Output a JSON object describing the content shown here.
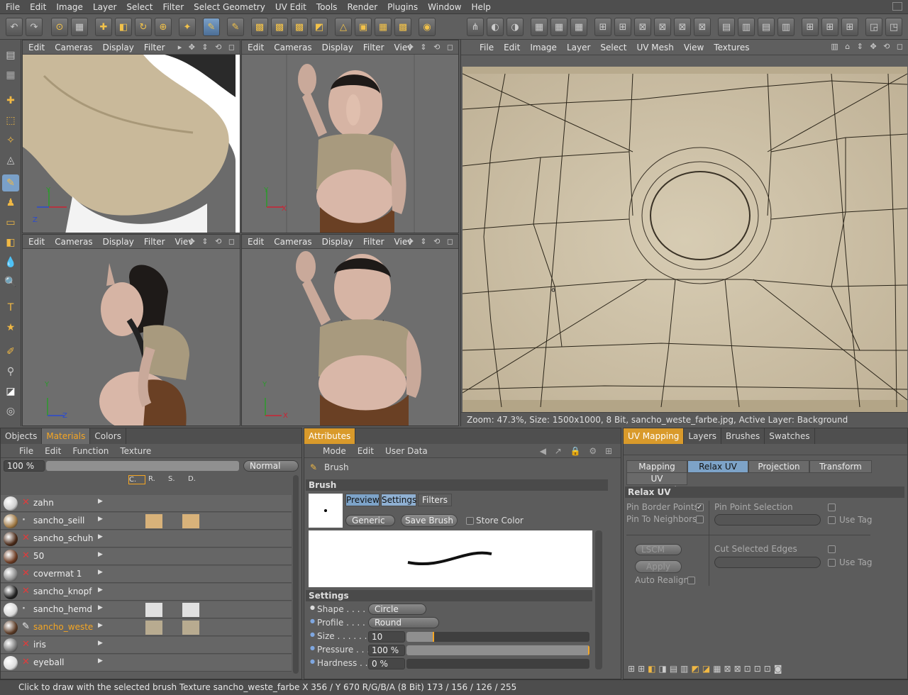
{
  "menu": [
    "File",
    "Edit",
    "Image",
    "Layer",
    "Select",
    "Filter",
    "Select Geometry",
    "UV Edit",
    "Tools",
    "Render",
    "Plugins",
    "Window",
    "Help"
  ],
  "viewport": {
    "menu": [
      "Edit",
      "Cameras",
      "Display",
      "Filter",
      "View"
    ],
    "filter_partial": "Filter",
    "view_partial": "Viev",
    "axis_x": "X",
    "axis_y": "Y",
    "axis_z": "Z"
  },
  "uv": {
    "menu": [
      "File",
      "Edit",
      "Image",
      "Layer",
      "Select",
      "UV Mesh",
      "View",
      "Textures"
    ],
    "status": "Zoom: 47.3%, Size: 1500x1000, 8 Bit, sancho_weste_farbe.jpg, Active Layer: Background"
  },
  "materials": {
    "tabs": [
      "Objects",
      "Materials",
      "Colors"
    ],
    "active_tab": "Materials",
    "submenu": [
      "File",
      "Edit",
      "Function",
      "Texture"
    ],
    "zoom": "100 %",
    "blend": "Normal",
    "channels": [
      "C.",
      "R.",
      "S.",
      "D."
    ],
    "items": [
      {
        "name": "zahn",
        "flag": "x",
        "color": "#cfcfcf"
      },
      {
        "name": "sancho_seill",
        "flag": "dot",
        "color": "#a07a45"
      },
      {
        "name": "sancho_schuh",
        "flag": "x",
        "color": "#4a2a18"
      },
      {
        "name": "50",
        "flag": "x",
        "color": "#6a3a22"
      },
      {
        "name": "covermat 1",
        "flag": "x",
        "color": "#888888"
      },
      {
        "name": "sancho_knopf",
        "flag": "x",
        "color": "#222222"
      },
      {
        "name": "sancho_hemd",
        "flag": "dot",
        "color": "#d8d8d8"
      },
      {
        "name": "sancho_weste",
        "flag": "brush",
        "color": "#5a3a25"
      },
      {
        "name": "iris",
        "flag": "x",
        "color": "#777777"
      },
      {
        "name": "eyeball",
        "flag": "x",
        "color": "#dddddd"
      }
    ],
    "active_item": "sancho_weste"
  },
  "attributes": {
    "tab": "Attributes",
    "submenu": [
      "Mode",
      "Edit",
      "User Data"
    ],
    "brush_title": "Brush",
    "section_brush": "Brush",
    "preview_tabs": [
      "Preview",
      "Settings",
      "Filters"
    ],
    "preset": "Generic",
    "save_brush": "Save Brush",
    "store_color": "Store Color",
    "section_settings": "Settings",
    "shape_label": "Shape . . . . .",
    "shape_value": "Circle",
    "profile_label": "Profile . . . . .",
    "profile_value": "Round",
    "size_label": "Size . . . . . . . .",
    "size_value": "10",
    "size_fraction": 0.15,
    "pressure_label": "Pressure . . .",
    "pressure_value": "100 %",
    "pressure_fraction": 1.0,
    "hardness_label": "Hardness . .",
    "hardness_value": "0 %",
    "hardness_fraction": 0.0
  },
  "uvmapping": {
    "tabs": [
      "UV Mapping",
      "Layers",
      "Brushes",
      "Swatches"
    ],
    "active_tab": "UV Mapping",
    "subtabs": [
      "Mapping",
      "Relax UV",
      "Projection",
      "Transform"
    ],
    "active_subtab": "Relax UV",
    "uv_commands": "UV Commands",
    "section": "Relax UV",
    "pin_border": "Pin Border Points",
    "pin_neighbors": "Pin To Neighbors",
    "pin_point_selection": "Pin Point Selection",
    "use_tag": "Use Tag",
    "method": "LSCM",
    "apply": "Apply",
    "auto_realign": "Auto Realign",
    "cut_selected_edges": "Cut Selected Edges"
  },
  "status": "Click to draw with the selected brush  Texture sancho_weste_farbe  X 356 / Y 670 R/G/B/A (8 Bit) 173 / 156 / 126 / 255",
  "colors": {
    "accent": "#f5a623",
    "selected_tab": "#7da3c8",
    "error_x": "#e23b3b",
    "uv_leather": "#cfc3a8"
  }
}
